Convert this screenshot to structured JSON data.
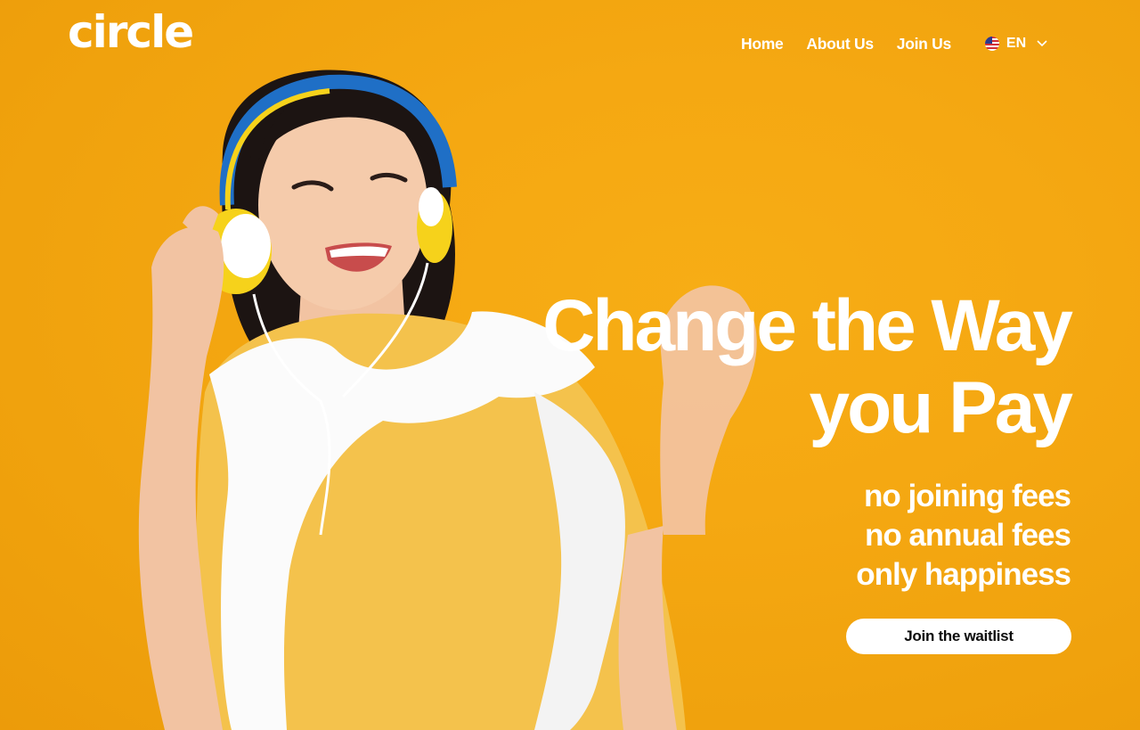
{
  "header": {
    "logo_text": "circle",
    "nav": {
      "home": "Home",
      "about": "About Us",
      "join": "Join Us"
    },
    "language": {
      "selected": "EN",
      "flag_icon": "us-flag-icon",
      "chevron_icon": "chevron-down-icon"
    }
  },
  "hero": {
    "headline_line1": "Change the Way",
    "headline_line2": "you Pay",
    "sub_line1": "no joining fees",
    "sub_line2": "no annual fees",
    "sub_line3": "only happiness",
    "cta_label": "Join the waitlist"
  },
  "colors": {
    "background": "#f5a812",
    "text": "#ffffff",
    "button_bg": "#ffffff",
    "button_text": "#0c0c0c",
    "shirt": "#f4c24c",
    "headphones_accent": "#1f6fc6",
    "headphones_cup": "#f6d21b"
  }
}
